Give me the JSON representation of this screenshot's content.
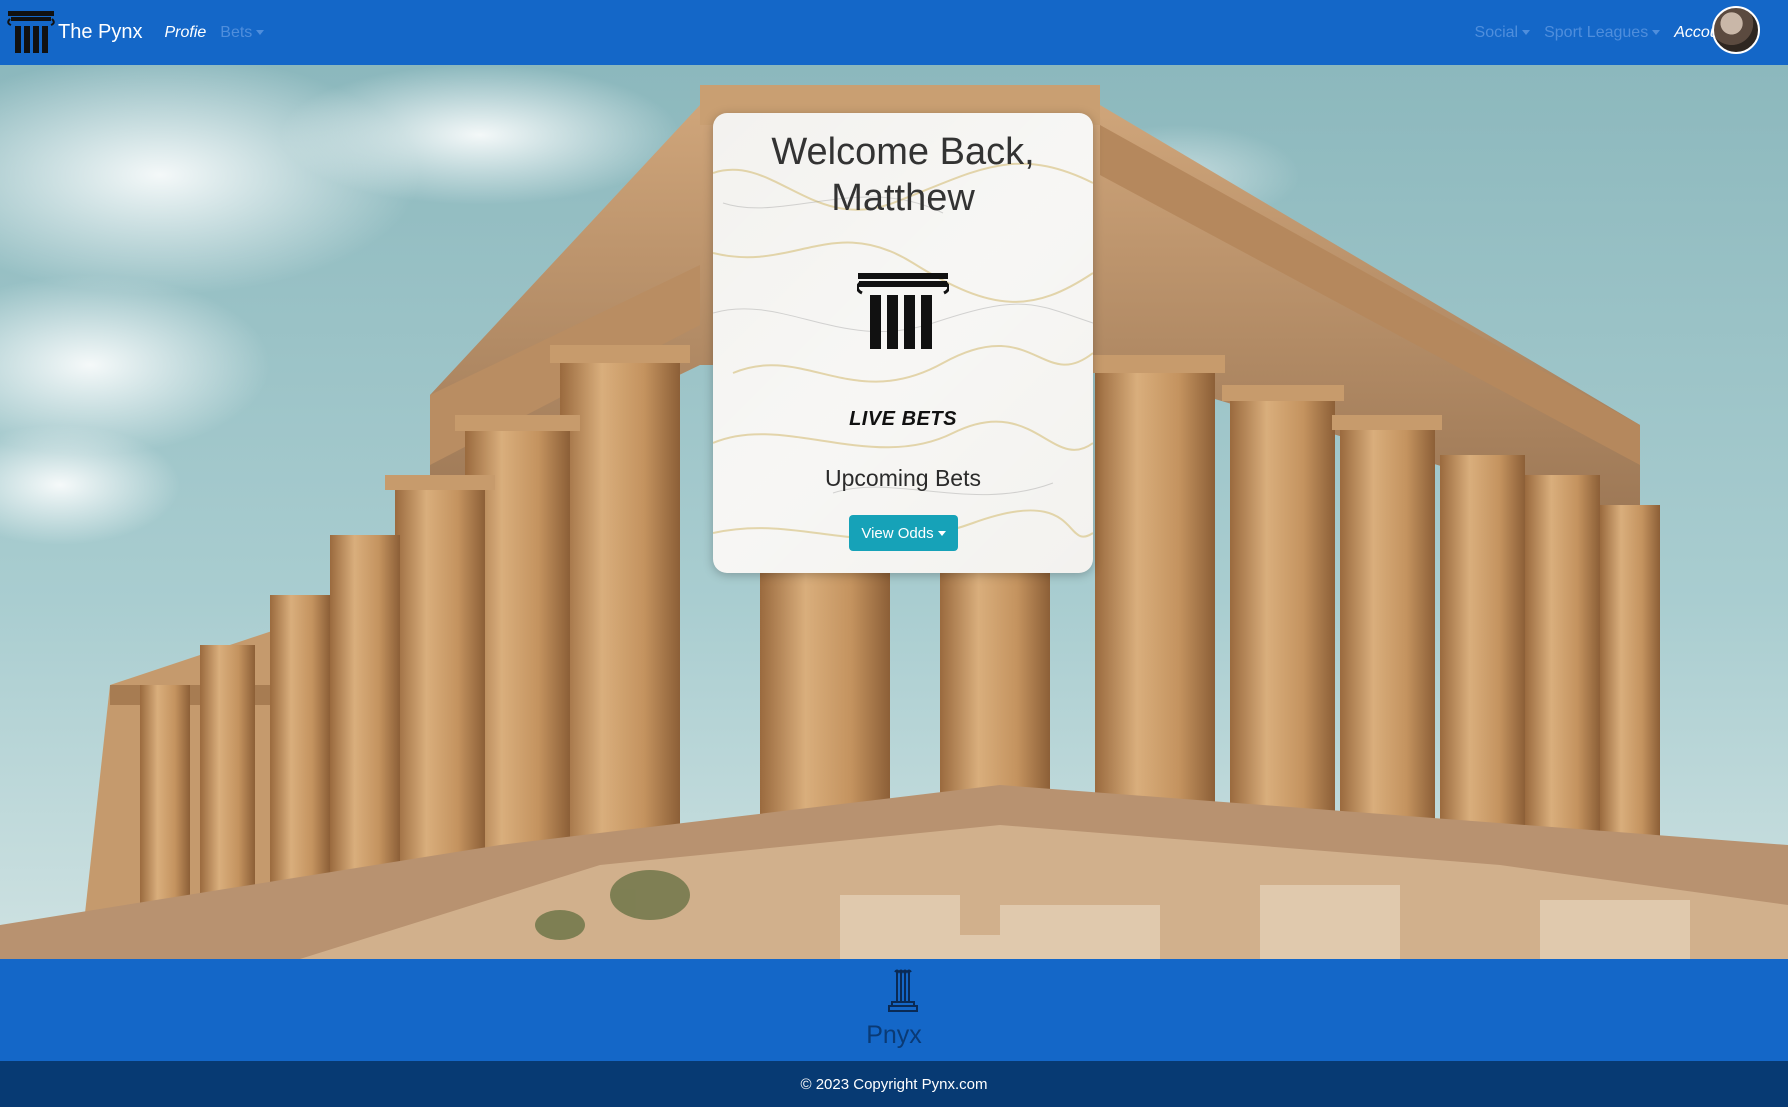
{
  "navbar": {
    "brand": "The Pynx",
    "left_links": [
      {
        "label": "Profie"
      },
      {
        "label": "Bets"
      }
    ],
    "right_links": [
      {
        "label": "Social"
      },
      {
        "label": "Sport Leagues"
      },
      {
        "label": "Account"
      }
    ],
    "avatar_icon": "user-avatar-icon"
  },
  "hero": {
    "image_icon": "parthenon-photo"
  },
  "card": {
    "title_line1": "Welcome Back,",
    "title_line2": "Matthew",
    "icon": "pillar-icon",
    "live_bets": "LIVE BETS",
    "upcoming": "Upcoming Bets",
    "button": "View Odds"
  },
  "footer": {
    "icon": "pillar-icon",
    "brand": "Pnyx",
    "copyright": "© 2023 Copyright Pynx.com"
  },
  "colors": {
    "primary": "#1467c8",
    "footer_dark": "#073a73",
    "button": "#16a2b8"
  }
}
